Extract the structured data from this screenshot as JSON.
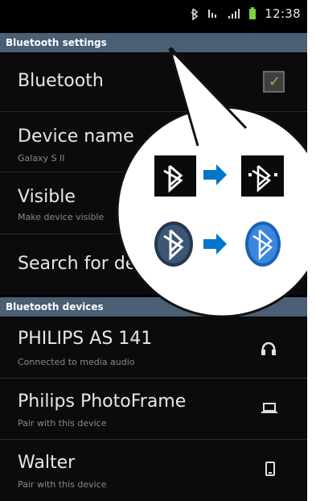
{
  "status": {
    "time": "12:38",
    "icons": [
      "bluetooth-icon",
      "signal-icon",
      "signal-bars-icon",
      "battery-icon"
    ]
  },
  "sections": {
    "bluetooth_settings": "Bluetooth settings",
    "bluetooth_devices": "Bluetooth devices"
  },
  "settings": {
    "bluetooth": {
      "label": "Bluetooth",
      "checked": true
    },
    "device_name": {
      "label": "Device name",
      "value": "Galaxy S II"
    },
    "visible": {
      "label": "Visible",
      "desc": "Make device visible"
    },
    "search": {
      "label": "Search for devices"
    }
  },
  "devices": [
    {
      "name": "PHILIPS AS 141",
      "status": "Connected to media audio",
      "icon": "headphones-icon"
    },
    {
      "name": "Philips PhotoFrame",
      "status": "Pair with this device",
      "icon": "laptop-icon"
    },
    {
      "name": "Walter",
      "status": "Pair with this device",
      "icon": "phone-icon"
    }
  ],
  "callout": {
    "items": [
      "bluetooth-on-icon",
      "bluetooth-connected-icon",
      "bluetooth-round-icon",
      "bluetooth-round-connected-icon"
    ]
  },
  "colors": {
    "section_header": "#4a5e74",
    "arrow_blue": "#0075c9",
    "checkbox_green": "#76c943"
  }
}
